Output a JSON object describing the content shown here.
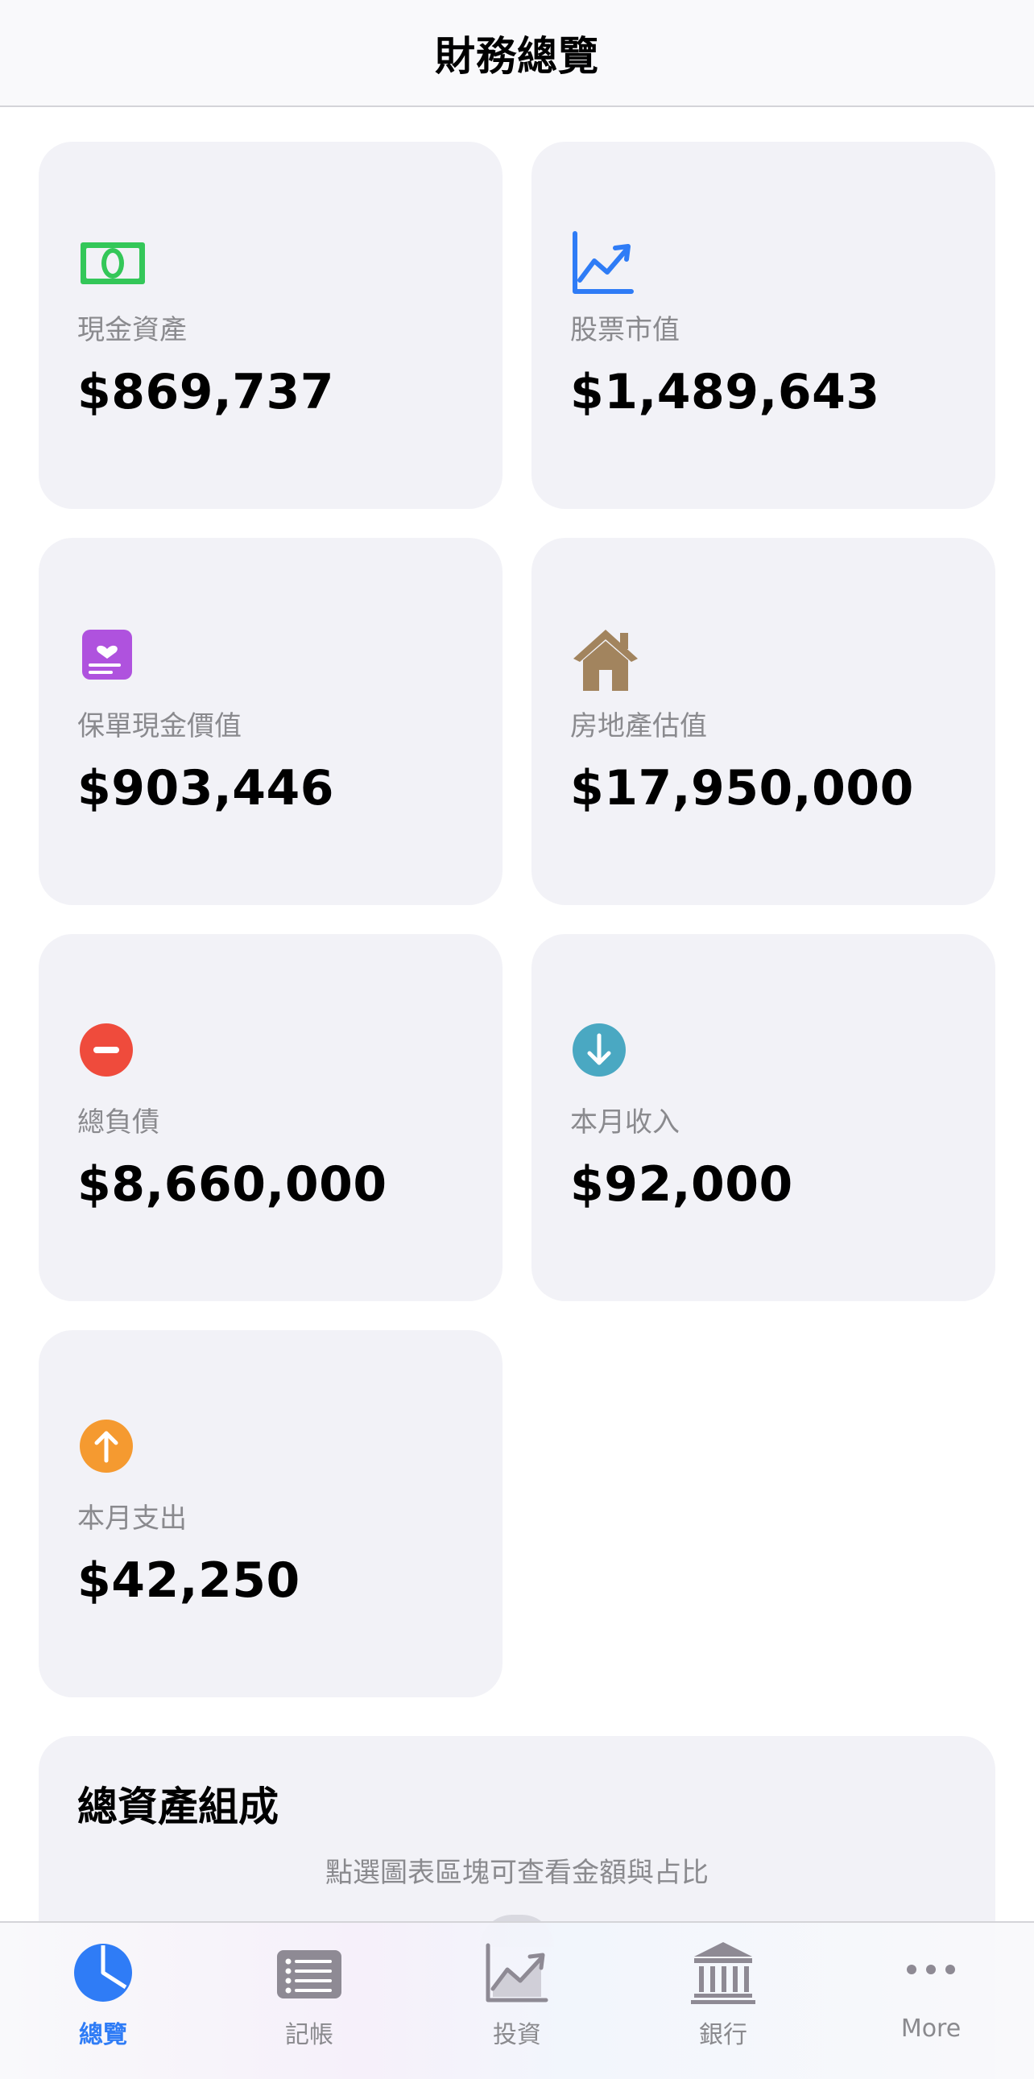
{
  "header": {
    "title": "財務總覽"
  },
  "cards": [
    {
      "id": "cash",
      "icon": "banknote-icon",
      "label": "現金資產",
      "value": "$869,737",
      "color": "#34c759"
    },
    {
      "id": "stocks",
      "icon": "chart-up-icon",
      "label": "股票市值",
      "value": "$1,489,643",
      "color": "#2f7cf6"
    },
    {
      "id": "insurance",
      "icon": "policy-heart-icon",
      "label": "保單現金價值",
      "value": "$903,446",
      "color": "#af52de"
    },
    {
      "id": "realestate",
      "icon": "house-icon",
      "label": "房地產估值",
      "value": "$17,950,000",
      "color": "#a2845e"
    },
    {
      "id": "liabilities",
      "icon": "minus-circle-icon",
      "label": "總負債",
      "value": "$8,660,000",
      "color": "#ff3b30"
    },
    {
      "id": "income",
      "icon": "arrow-down-circle-icon",
      "label": "本月收入",
      "value": "$92,000",
      "color": "#30b0c7"
    },
    {
      "id": "expense",
      "icon": "arrow-up-circle-icon",
      "label": "本月支出",
      "value": "$42,250",
      "color": "#ff9500"
    }
  ],
  "composition": {
    "title": "總資產組成",
    "hint": "點選圖表區塊可查看金額與占比"
  },
  "tabs": [
    {
      "label": "總覽",
      "icon": "pie-chart-icon",
      "active": true
    },
    {
      "label": "記帳",
      "icon": "list-icon",
      "active": false
    },
    {
      "label": "投資",
      "icon": "chart-line-icon",
      "active": false
    },
    {
      "label": "銀行",
      "icon": "bank-icon",
      "active": false
    },
    {
      "label": "More",
      "icon": "more-dots-icon",
      "active": false
    }
  ],
  "colors": {
    "accent": "#2f7cf6",
    "card_bg": "#f2f2f7",
    "secondary_text": "#8a8a8e"
  }
}
